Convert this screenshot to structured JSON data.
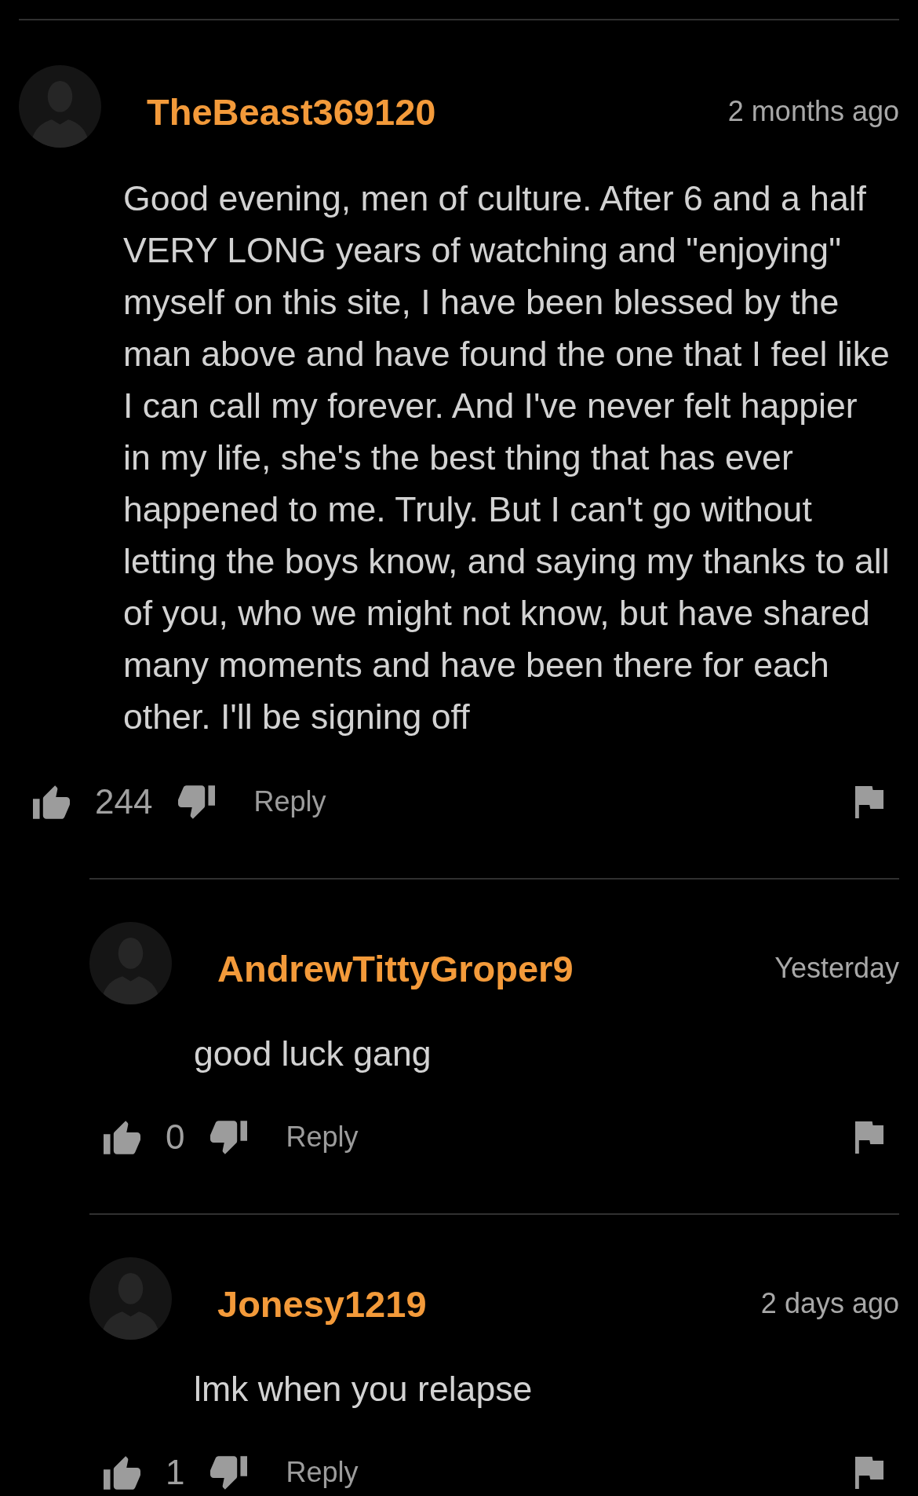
{
  "comments": [
    {
      "username": "TheBeast369120",
      "time": "2 months ago",
      "text": "Good evening, men of culture. After 6 and a half VERY LONG years of watching and \"enjoying\" myself on this site, I have been blessed by the man above and have found the one that I feel like I can call my forever. And I've never felt happier in my life, she's the best thing that has ever happened to me. Truly. But I can't go without letting the boys know, and saying my thanks to all of you, who we might not know, but have shared many moments and have been there for each other. I'll be signing off",
      "likes": "244",
      "reply_label": "Reply",
      "replies": [
        {
          "username": "AndrewTittyGroper9",
          "time": "Yesterday",
          "text": "good luck gang",
          "likes": "0",
          "reply_label": "Reply"
        },
        {
          "username": "Jonesy1219",
          "time": "2 days ago",
          "text": "lmk when you relapse",
          "likes": "1",
          "reply_label": "Reply"
        }
      ]
    }
  ]
}
